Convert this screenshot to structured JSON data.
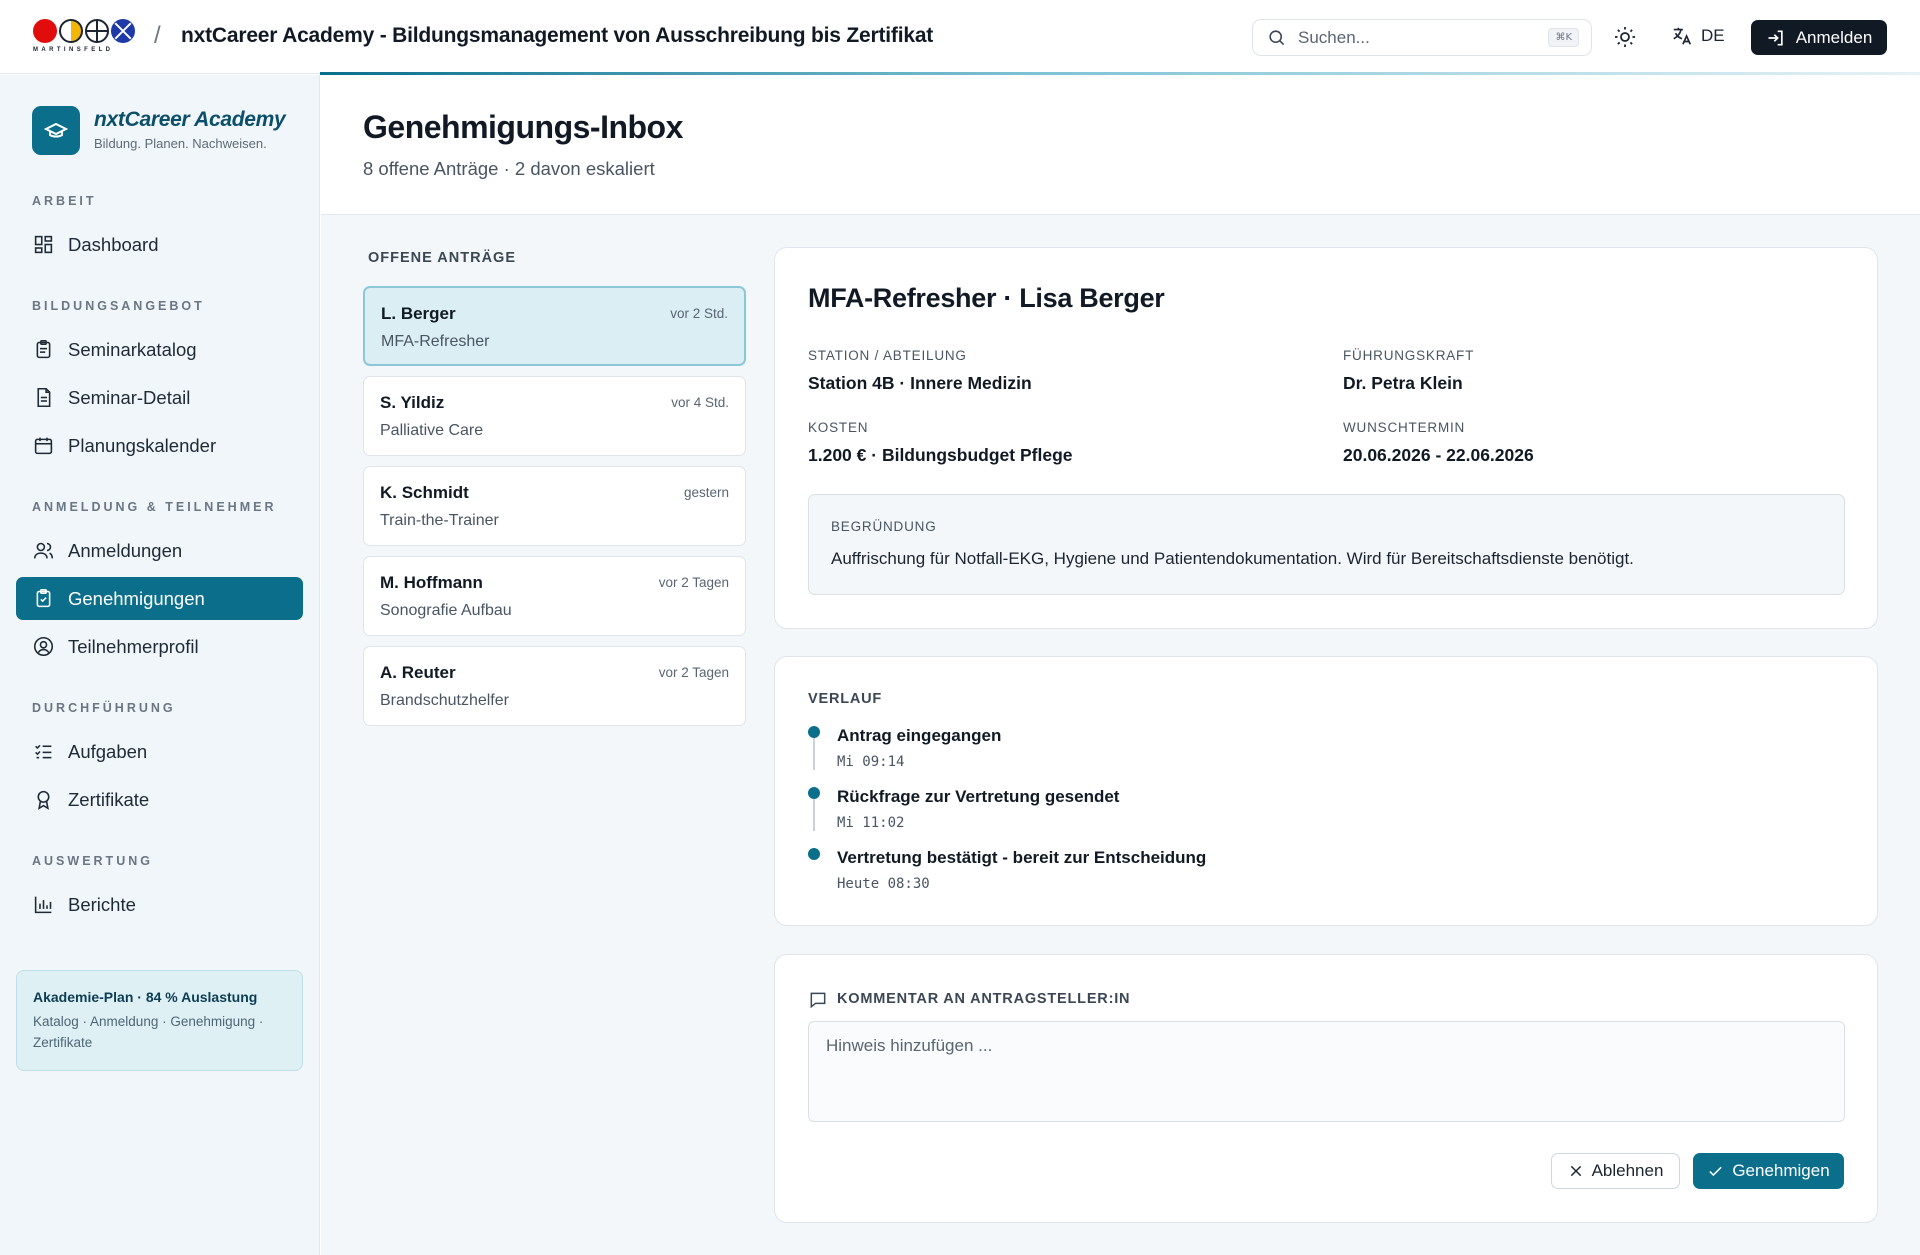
{
  "header": {
    "logo_wordmark": "MARTINSFELD",
    "separator": "/",
    "app_title": "nxtCareer Academy - Bildungsmanagement von Ausschreibung bis Zertifikat",
    "search_placeholder": "Suchen...",
    "search_shortcut": "⌘K",
    "language": "DE",
    "login_label": "Anmelden"
  },
  "sidebar": {
    "brand_name": "nxtCareer Academy",
    "brand_tagline": "Bildung. Planen. Nachweisen.",
    "sections": {
      "arbeit": "ARBEIT",
      "bildungsangebot": "BILDUNGSANGEBOT",
      "anmeldung": "ANMELDUNG & TEILNEHMER",
      "durchfuehrung": "DURCHFÜHRUNG",
      "auswertung": "AUSWERTUNG"
    },
    "items": {
      "dashboard": "Dashboard",
      "seminarkatalog": "Seminarkatalog",
      "seminar_detail": "Seminar-Detail",
      "planungskalender": "Planungskalender",
      "anmeldungen": "Anmeldungen",
      "genehmigungen": "Genehmigungen",
      "teilnehmerprofil": "Teilnehmerprofil",
      "aufgaben": "Aufgaben",
      "zertifikate": "Zertifikate",
      "berichte": "Berichte"
    },
    "active_item": "Genehmigungen",
    "plan_card": {
      "title": "Akademie-Plan · 84 % Auslastung",
      "subtitle": "Katalog · Anmeldung · Genehmigung · Zertifikate"
    }
  },
  "page": {
    "title": "Genehmigungs-Inbox",
    "subtitle": "8 offene Anträge · 2 davon eskaliert"
  },
  "requests": {
    "label": "OFFENE ANTRÄGE",
    "items": [
      {
        "name": "L. Berger",
        "course": "MFA-Refresher",
        "time": "vor 2 Std."
      },
      {
        "name": "S. Yildiz",
        "course": "Palliative Care",
        "time": "vor 4 Std."
      },
      {
        "name": "K. Schmidt",
        "course": "Train-the-Trainer",
        "time": "gestern"
      },
      {
        "name": "M. Hoffmann",
        "course": "Sonografie Aufbau",
        "time": "vor 2 Tagen"
      },
      {
        "name": "A. Reuter",
        "course": "Brandschutzhelfer",
        "time": "vor 2 Tagen"
      }
    ]
  },
  "detail": {
    "title": "MFA-Refresher · Lisa Berger",
    "station_label": "STATION / ABTEILUNG",
    "station_value": "Station 4B · Innere Medizin",
    "manager_label": "FÜHRUNGSKRAFT",
    "manager_value": "Dr. Petra Klein",
    "cost_label": "KOSTEN",
    "cost_value": "1.200 € · Bildungsbudget Pflege",
    "date_label": "WUNSCHTERMIN",
    "date_value": "20.06.2026 - 22.06.2026",
    "reason_label": "BEGRÜNDUNG",
    "reason_value": "Auffrischung für Notfall-EKG, Hygiene und Patientendokumentation. Wird für Bereitschaftsdienste benötigt."
  },
  "history": {
    "label": "VERLAUF",
    "events": [
      {
        "title": "Antrag eingegangen",
        "time": "Mi 09:14"
      },
      {
        "title": "Rückfrage zur Vertretung gesendet",
        "time": "Mi 11:02"
      },
      {
        "title": "Vertretung bestätigt - bereit zur Entscheidung",
        "time": "Heute 08:30"
      }
    ]
  },
  "comment": {
    "label": "KOMMENTAR AN ANTRAGSTELLER:IN",
    "placeholder": "Hinweis hinzufügen ...",
    "reject_label": "Ablehnen",
    "approve_label": "Genehmigen"
  },
  "colors": {
    "accent": "#0b6f8c",
    "sidebar_bg": "#f0f6f9",
    "primary_dark": "#111a24"
  },
  "icons": [
    "search-icon",
    "sun-icon",
    "translate-icon",
    "login-icon",
    "graduation-cap-icon",
    "dashboard-icon",
    "clipboard-icon",
    "document-icon",
    "calendar-icon",
    "users-icon",
    "clipboard-check-icon",
    "user-circle-icon",
    "checklist-icon",
    "award-icon",
    "bar-chart-icon",
    "comment-icon",
    "close-icon",
    "check-icon"
  ]
}
